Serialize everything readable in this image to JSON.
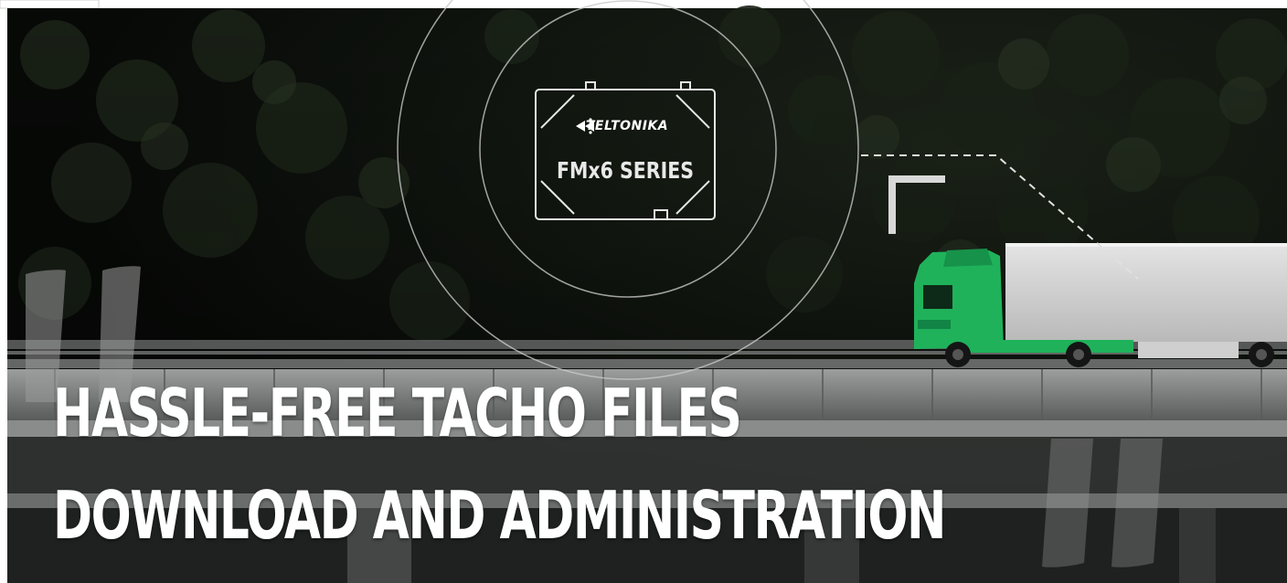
{
  "banner": {
    "device_brand": "TELTONIKA",
    "device_series": "FMx6 SERIES",
    "headline_line1": "HASSLE-FREE TACHO FILES",
    "headline_line2": "DOWNLOAD AND ADMINISTRATION"
  },
  "icons": {
    "brand_logo": "teltonika-arrows-logo",
    "open_quote": "open-quote-icon",
    "close_quote": "close-quote-icon"
  },
  "colors": {
    "forest_background": "#0b0e0a",
    "truck_cab": "#1fb25a",
    "trailer": "#d7d7d7",
    "bridge": "#8c8e8e",
    "text": "#ffffff"
  }
}
